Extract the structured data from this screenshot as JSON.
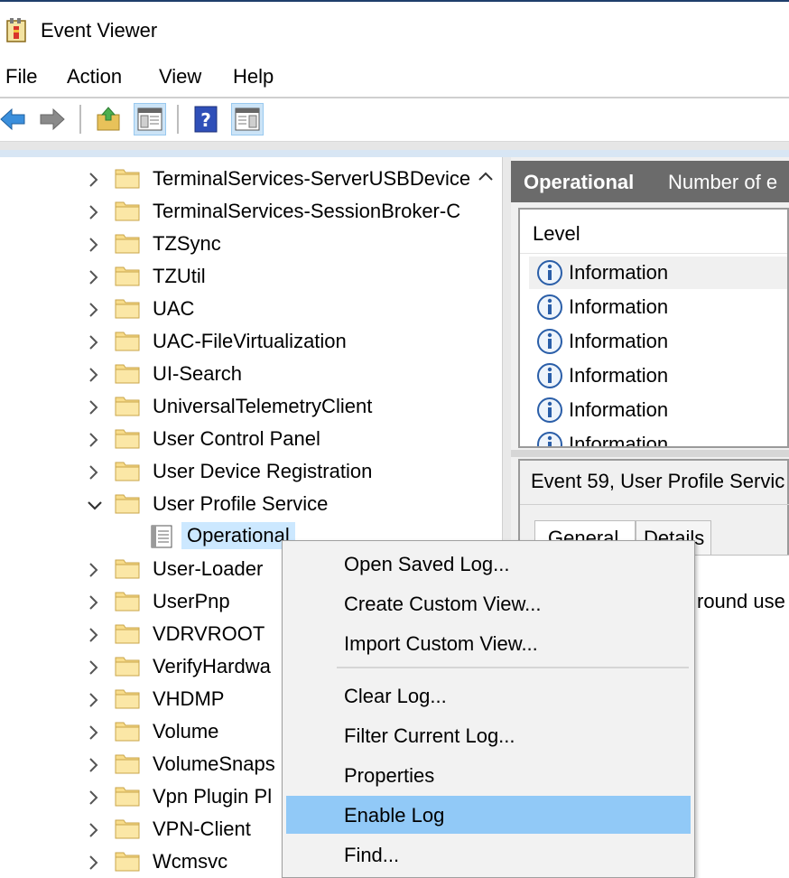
{
  "window": {
    "title": "Event Viewer"
  },
  "menu": [
    "File",
    "Action",
    "View",
    "Help"
  ],
  "toolbar": {
    "icons": [
      "back-arrow-icon",
      "forward-arrow-icon",
      "up-folder-icon",
      "show-hide-tree-icon",
      "help-icon",
      "show-hide-action-pane-icon"
    ]
  },
  "tree": {
    "items": [
      {
        "label": "TerminalServices-ServerUSBDevice",
        "expanded": false
      },
      {
        "label": "TerminalServices-SessionBroker-C",
        "expanded": false
      },
      {
        "label": "TZSync",
        "expanded": false
      },
      {
        "label": "TZUtil",
        "expanded": false
      },
      {
        "label": "UAC",
        "expanded": false
      },
      {
        "label": "UAC-FileVirtualization",
        "expanded": false
      },
      {
        "label": "UI-Search",
        "expanded": false
      },
      {
        "label": "UniversalTelemetryClient",
        "expanded": false
      },
      {
        "label": "User Control Panel",
        "expanded": false
      },
      {
        "label": "User Device Registration",
        "expanded": false
      },
      {
        "label": "User Profile Service",
        "expanded": true
      },
      {
        "label": "Operational",
        "child": true,
        "selected": true
      },
      {
        "label": "User-Loader",
        "expanded": false
      },
      {
        "label": "UserPnp",
        "expanded": false
      },
      {
        "label": "VDRVROOT",
        "expanded": false
      },
      {
        "label": "VerifyHardwa",
        "expanded": false
      },
      {
        "label": "VHDMP",
        "expanded": false
      },
      {
        "label": "Volume",
        "expanded": false
      },
      {
        "label": "VolumeSnaps",
        "expanded": false
      },
      {
        "label": "Vpn Plugin Pl",
        "expanded": false
      },
      {
        "label": "VPN-Client",
        "expanded": false
      },
      {
        "label": "Wcmsvc",
        "expanded": false
      }
    ]
  },
  "log_header": {
    "title": "Operational",
    "count_text": "Number of e"
  },
  "events": {
    "column": "Level",
    "rows": [
      "Information",
      "Information",
      "Information",
      "Information",
      "Information",
      "Information"
    ]
  },
  "detail": {
    "title": "Event 59, User Profile Servic",
    "tabs": [
      "General",
      "Details"
    ],
    "description_fragment": "round use"
  },
  "context_menu": {
    "groups": [
      [
        "Open Saved Log...",
        "Create Custom View...",
        "Import Custom View..."
      ],
      [
        "Clear Log...",
        "Filter Current Log...",
        "Properties",
        "Enable Log",
        "Find..."
      ]
    ],
    "highlighted": "Enable Log"
  },
  "colors": {
    "header_bg": "#6b6b6b",
    "selection": "#cce8ff",
    "menu_highlight": "#91c9f7"
  }
}
